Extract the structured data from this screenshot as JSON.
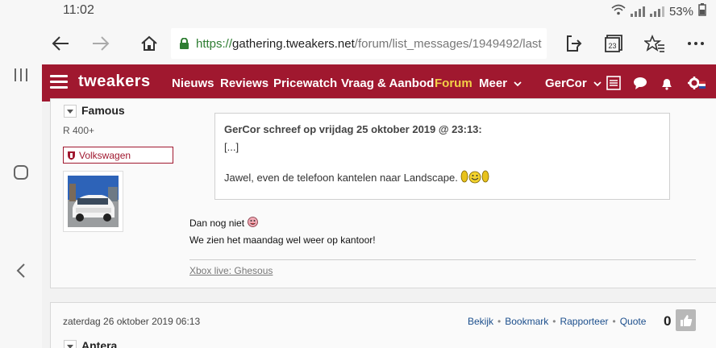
{
  "status": {
    "time": "11:02",
    "battery": "53%"
  },
  "browser": {
    "url_scheme": "https://",
    "url_host": "gathering.tweakers.net",
    "url_path": "/forum/list_messages/1949492/last",
    "tab_count": "23"
  },
  "site_nav": {
    "logo": "tweakers",
    "items": [
      "Nieuws",
      "Reviews",
      "Pricewatch",
      "Vraag & Aanbod",
      "Forum",
      "Meer"
    ],
    "user": "GerCor",
    "accent": "#a0182f",
    "active_color": "#f3d047"
  },
  "post1": {
    "username": "Famous",
    "rank": "R 400+",
    "badge": "Volkswagen",
    "quote_header": "GerCor schreef op vrijdag 25 oktober 2019 @ 23:13:",
    "quote_ellipsis": "[...]",
    "quote_text": "Jawel, even de telefoon kantelen naar Landscape.",
    "line1": "Dan nog niet",
    "line2": "We zien het maandag wel weer op kantoor!",
    "signature": "Xbox live: Ghesous"
  },
  "post2": {
    "date": "zaterdag 26 oktober 2019 06:13",
    "actions": [
      "Bekijk",
      "Bookmark",
      "Rapporteer",
      "Quote"
    ],
    "score": "0",
    "username": "Antera"
  },
  "icons": [
    "recents-icon",
    "home-circle-icon",
    "back-nav-icon",
    "back-arrow-icon",
    "forward-arrow-icon",
    "home-icon",
    "lock-icon",
    "share-icon",
    "tabs-icon",
    "favorites-icon",
    "more-icon",
    "menu-icon",
    "chevron-down-icon",
    "list-icon",
    "chat-icon",
    "bell-icon",
    "settings-icon",
    "thumbs-up-icon"
  ]
}
